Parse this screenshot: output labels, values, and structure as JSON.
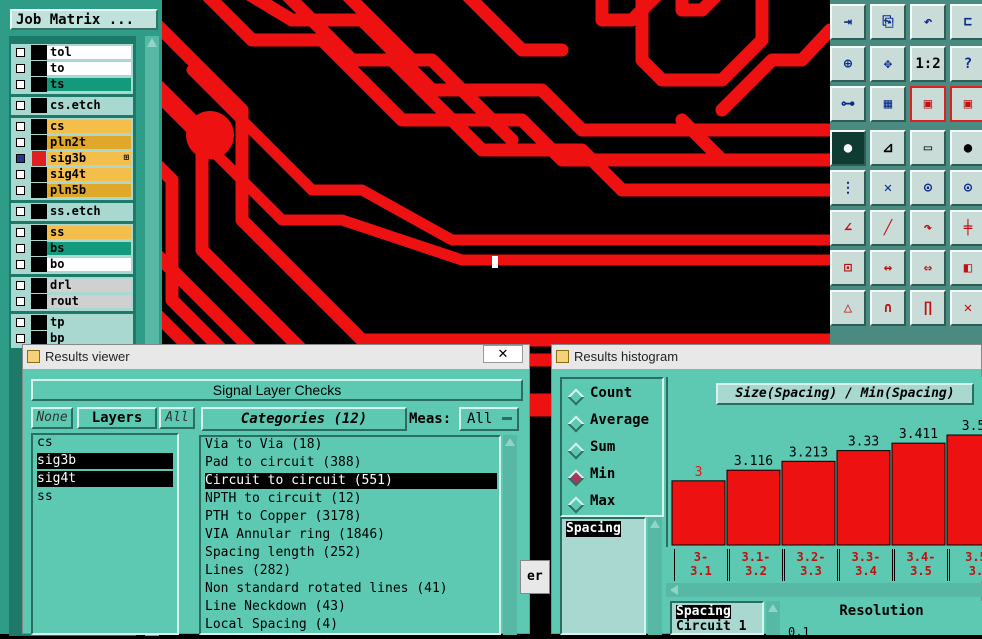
{
  "job_matrix": {
    "title": "Job Matrix ...",
    "layers": [
      {
        "name": "tol",
        "color": "#ffffff",
        "checked": false
      },
      {
        "name": "to",
        "color": "#ffffff",
        "checked": false
      },
      {
        "name": "ts",
        "color": "#139a7c",
        "checked": false
      },
      {
        "name": "cs.etch",
        "color": "#a8d8d0",
        "checked": false
      },
      {
        "name": "cs",
        "color": "#f4be4a",
        "checked": false
      },
      {
        "name": "pln2t",
        "color": "#e0a82a",
        "checked": false
      },
      {
        "name": "sig3b",
        "color": "#f4be4a",
        "checked": true,
        "marker": "⊞"
      },
      {
        "name": "sig4t",
        "color": "#f4be4a",
        "checked": false
      },
      {
        "name": "pln5b",
        "color": "#e0a82a",
        "checked": false
      },
      {
        "name": "ss.etch",
        "color": "#a8d8d0",
        "checked": false
      },
      {
        "name": "ss",
        "color": "#f4be4a",
        "checked": false
      },
      {
        "name": "bs",
        "color": "#139a7c",
        "checked": false
      },
      {
        "name": "bo",
        "color": "#ffffff",
        "checked": false
      },
      {
        "name": "drl",
        "color": "#d0d0d0",
        "checked": false
      },
      {
        "name": "rout",
        "color": "#d0d0d0",
        "checked": false
      },
      {
        "name": "tp",
        "color": "#a8d8d0",
        "checked": false
      },
      {
        "name": "bp",
        "color": "#a8d8d0",
        "checked": false
      }
    ]
  },
  "toolbar": {
    "buttons": [
      "step-icon",
      "copy-icon",
      "undo-icon",
      "snap-icon",
      "center-icon",
      "pan-icon",
      "scale-1-2",
      "help-icon",
      "select-icon",
      "grid-icon",
      "layer-a-icon",
      "layer-b-icon",
      "pad-icon",
      "feature-icon",
      "ruler-icon",
      "circle-icon",
      "connect-icon",
      "delete-icon",
      "add-pad-icon",
      "add-line-icon",
      "angle-icon",
      "line-icon",
      "arc-icon",
      "double-line-icon",
      "break-icon",
      "stretch-icon",
      "measure-icon",
      "shape-icon",
      "triangle-icon",
      "arch-icon",
      "arch-bar-icon",
      "cross-icon"
    ],
    "scale_label": "1:2"
  },
  "results_viewer": {
    "title": "Results viewer",
    "close": "✕",
    "heading": "Signal Layer Checks",
    "none_label": "None",
    "layers_label": "Layers",
    "all_label": "All",
    "categories_label": "Categories (12)",
    "meas_label": "Meas:",
    "meas_value": "All",
    "layers": [
      "cs",
      "sig3b",
      "sig4t",
      "ss"
    ],
    "selected_layers": [
      1,
      2
    ],
    "categories": [
      "Via to Via (18)",
      "Pad to circuit (388)",
      "Circuit to circuit (551)",
      "NPTH to circuit (12)",
      "PTH to Copper (3178)",
      "VIA Annular ring (1846)",
      "Spacing length (252)",
      "Lines (282)",
      "Non standard rotated lines (41)",
      "Line Neckdown (43)",
      "Local Spacing (4)"
    ],
    "selected_category": 2
  },
  "results_histogram": {
    "title": "Results histogram",
    "modes": [
      "Count",
      "Average",
      "Sum",
      "Min",
      "Max"
    ],
    "selected_mode": "Min",
    "list": [
      "Spacing"
    ],
    "list_selected": 0,
    "chart_title": "Size(Spacing) / Min(Spacing)",
    "bottom_list": [
      "Spacing",
      "Circuit 1"
    ],
    "resolution_label": "Resolution",
    "resolution_value": "0.1"
  },
  "chart_data": {
    "type": "bar",
    "title": "Size(Spacing) / Min(Spacing)",
    "categories": [
      "3-3.1",
      "3.1-3.2",
      "3.2-3.3",
      "3.3-3.4",
      "3.4-3.5",
      "3.5"
    ],
    "values": [
      3,
      3.116,
      3.213,
      3.33,
      3.411,
      3.5
    ],
    "value_labels": [
      "3",
      "3.116",
      "3.213",
      "3.33",
      "3.411",
      "3.5"
    ],
    "category_labels": [
      [
        "3-",
        "3.1"
      ],
      [
        "3.1-",
        "3.2"
      ],
      [
        "3.2-",
        "3.3"
      ],
      [
        "3.3-",
        "3.4"
      ],
      [
        "3.4-",
        "3.5"
      ],
      [
        "3.5",
        "3."
      ]
    ],
    "bar_color": "#ee1111",
    "first_label_color": "#ee1111"
  },
  "partial_labels": {
    "er": "er"
  }
}
